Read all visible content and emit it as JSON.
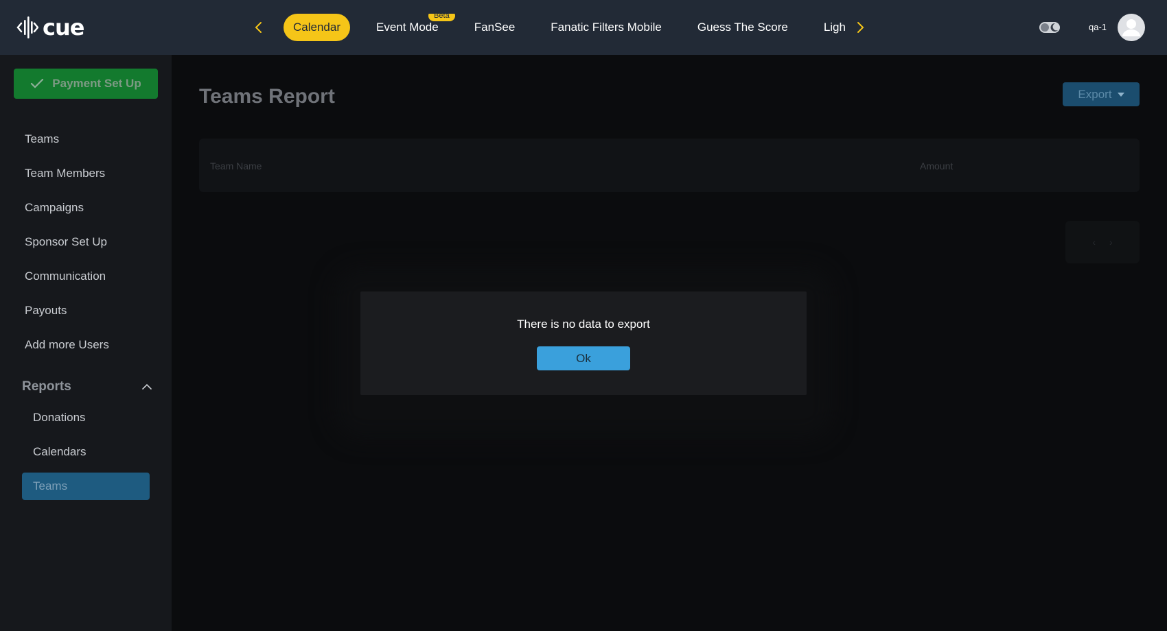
{
  "app": {
    "logo_text": "cue"
  },
  "topnav": {
    "tabs": [
      {
        "label": "Calendar",
        "active": true
      },
      {
        "label": "Event Mode",
        "badge": "Beta"
      },
      {
        "label": "FanSee"
      },
      {
        "label": "Fanatic Filters Mobile"
      },
      {
        "label": "Guess The Score"
      },
      {
        "label": "Light"
      }
    ],
    "username": "qa-1"
  },
  "sidebar": {
    "payment_button": "Payment Set Up",
    "items": [
      "Teams",
      "Team Members",
      "Campaigns",
      "Sponsor Set Up",
      "Communication",
      "Payouts",
      "Add more Users"
    ],
    "reports": {
      "label": "Reports",
      "sub_items": [
        "Donations",
        "Calendars",
        "Teams"
      ],
      "active": "Teams"
    }
  },
  "main": {
    "title": "Teams Report",
    "export_label": "Export",
    "columns": [
      "Team Name",
      "Amount"
    ]
  },
  "modal": {
    "message": "There is no data to export",
    "ok_label": "Ok"
  },
  "colors": {
    "accent_yellow": "#f5c518",
    "topbar_bg": "#222a36",
    "payment_green": "#137a2e",
    "ok_blue": "#3aa0dc",
    "active_sidebar": "#1e5b80"
  }
}
